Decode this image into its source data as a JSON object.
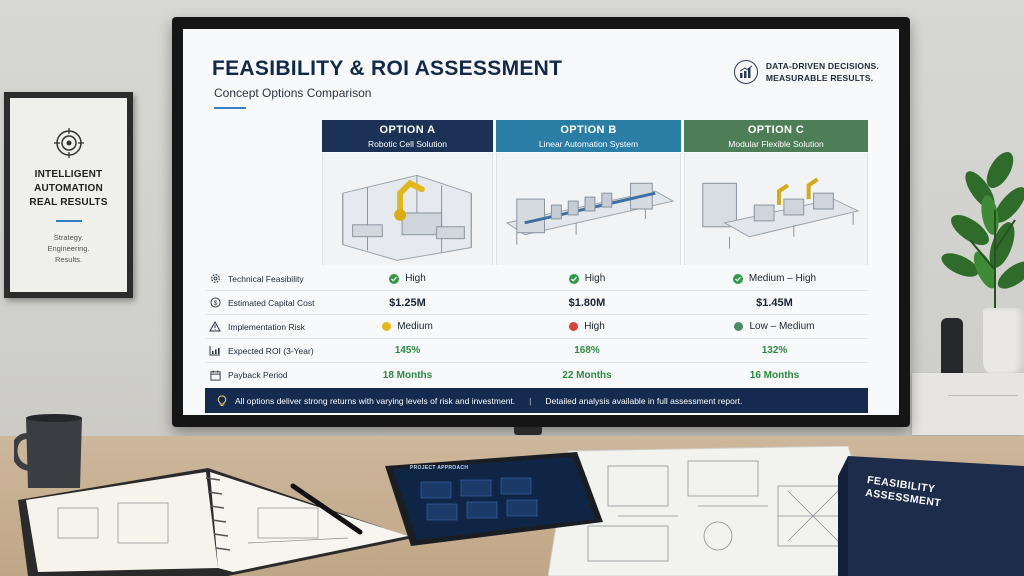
{
  "wall_frame": {
    "icon": "target-icon",
    "headline": [
      "INTELLIGENT",
      "AUTOMATION",
      "REAL RESULTS"
    ],
    "sub": [
      "Strategy.",
      "Engineering.",
      "Results."
    ]
  },
  "screen": {
    "title": "FEASIBILITY & ROI ASSESSMENT",
    "subtitle": "Concept Options Comparison",
    "tagline": [
      "DATA-DRIVEN DECISIONS.",
      "MEASURABLE RESULTS."
    ],
    "tagline_icon": "chart-growth-icon",
    "options": [
      {
        "name": "OPTION A",
        "desc": "Robotic Cell Solution",
        "color": "#1b3256"
      },
      {
        "name": "OPTION B",
        "desc": "Linear Automation System",
        "color": "#2a7ea6"
      },
      {
        "name": "OPTION C",
        "desc": "Modular Flexible Solution",
        "color": "#4e7e57"
      }
    ],
    "metrics": [
      {
        "label": "Technical Feasibility",
        "icon": "gear-icon",
        "values": [
          "High",
          "High",
          "Medium – High"
        ],
        "status": [
          "check",
          "check",
          "check"
        ]
      },
      {
        "label": "Estimated Capital Cost",
        "icon": "dollar-icon",
        "values": [
          "$1.25M",
          "$1.80M",
          "$1.45M"
        ]
      },
      {
        "label": "Implementation Risk",
        "icon": "warning-icon",
        "values": [
          "Medium",
          "High",
          "Low – Medium"
        ],
        "dot_colors": [
          "#e8b618",
          "#d9403a",
          "#4e8a68"
        ]
      },
      {
        "label": "Expected ROI (3-Year)",
        "icon": "growth-chart-icon",
        "values": [
          "145%",
          "168%",
          "132%"
        ]
      },
      {
        "label": "Payback Period",
        "icon": "calendar-icon",
        "values": [
          "18 Months",
          "22 Months",
          "16 Months"
        ]
      }
    ],
    "banner": {
      "icon": "lightbulb-icon",
      "text_1": "All options deliver strong returns with varying levels of risk and investment.",
      "separator": "|",
      "text_2": "Detailed analysis available in full assessment report."
    }
  },
  "desk": {
    "tablet_header": "PROJECT APPROACH",
    "binder_title": [
      "FEASIBILITY",
      "ASSESSMENT"
    ]
  }
}
